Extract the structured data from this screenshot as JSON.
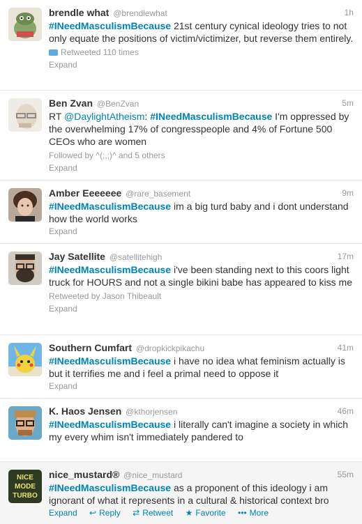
{
  "tweets": [
    {
      "name": "brendle what",
      "handle": "@brendlewhat",
      "time": "1h",
      "hashtag": "#INeedMasculismBecause",
      "text": " 21st century cynical ideology tries to not only equate the positions of victim/victimizer, but reverse them entirely.",
      "meta": "Retweeted 110 times",
      "expand": "Expand",
      "avatar_color": "#8aa36b"
    },
    {
      "name": "Ben Zvan",
      "handle": "@BenZvan",
      "time": "5m",
      "prefix": "RT ",
      "mention": "@DaylightAtheism",
      "mid": ": ",
      "hashtag": "#INeedMasculismBecause",
      "text": " I'm oppressed by the overwhelming 17% of congresspeople and 4% of Fortune 500 CEOs who are women",
      "meta": "Followed by ^(;,;)^ and 5 others",
      "expand": "Expand",
      "avatar_color": "#d9d2c8"
    },
    {
      "name": "Amber Eeeeeee",
      "handle": "@rare_basement",
      "time": "9m",
      "hashtag": "#INeedMasculismBecause",
      "text": " im a big turd baby and i dont understand how the world works",
      "expand": "Expand",
      "avatar_color": "#7a5a48"
    },
    {
      "name": "Jay Satellite",
      "handle": "@satellitehigh",
      "time": "17m",
      "hashtag": "#INeedMasculismBecause",
      "text": " i've been standing next to this coors light truck for HOURS and not a single bikini babe has appeared to kiss me",
      "meta": "Retweeted by Jason Thibeault",
      "expand": "Expand",
      "avatar_color": "#5a5048"
    },
    {
      "name": "Southern Cumfart",
      "handle": "@dropkickpikachu",
      "time": "41m",
      "hashtag": "#INeedMasculismBecause",
      "text": " i have no idea what feminism actually is but it terrifies me and i feel a primal need to oppose it",
      "expand": "Expand",
      "avatar_color": "#f2d23a"
    },
    {
      "name": "K. Haos Jensen",
      "handle": "@kthorjensen",
      "time": "46m",
      "hashtag": "#INeedMasculismBecause",
      "text": " i literally can't imagine a society in which my every whim isn't immediately pandered to",
      "expand": "Expand",
      "avatar_color": "#c08a4a"
    },
    {
      "name": "nice_mustard®",
      "handle": "@nice_mustard",
      "time": "55m",
      "hashtag": "#INeedMasculismBecause",
      "text": " as a proponent of this ideology i am ignorant of what it represents in a cultural & historical context bro",
      "avatar_color": "#2e3a22",
      "avatar_text": "NICE MODE TURBO",
      "actions": {
        "expand": "Expand",
        "reply": "Reply",
        "retweet": "Retweet",
        "favorite": "Favorite",
        "more": "More"
      }
    }
  ]
}
